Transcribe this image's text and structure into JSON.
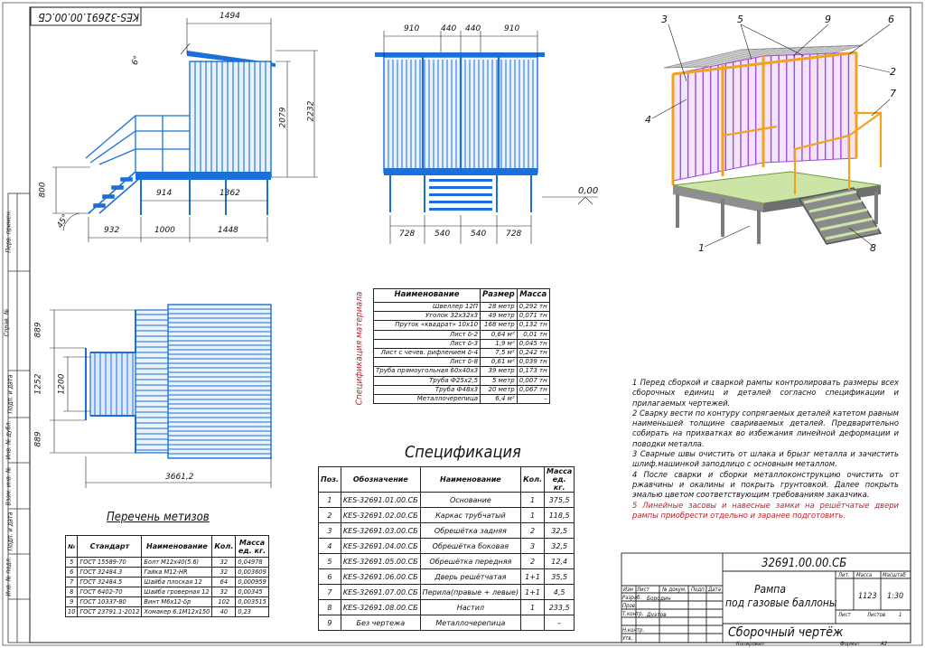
{
  "colors": {
    "structure": "#1a6fd8",
    "violet": "#a14bd6",
    "orange": "#f3a21a",
    "green_top": "#cce5a6",
    "steel": "#7d7d7d",
    "red_text": "#c0202a"
  },
  "stamp_top": "KES-32691.00.00.СБ",
  "side_view": {
    "dim_top": "1494",
    "angle": "6°",
    "dim_h1": "2079",
    "dim_h2": "2232",
    "dim_rail": "800",
    "angle_bottom": "45°",
    "dim_a": "914",
    "dim_b": "1362",
    "dim_c": "932",
    "dim_d": "1000",
    "dim_e": "1448"
  },
  "front_view": {
    "top_dims": [
      "910",
      "440",
      "440",
      "910"
    ],
    "bottom_dims": [
      "728",
      "540",
      "540",
      "728"
    ],
    "level": "0,00"
  },
  "plan_view": {
    "dims_left": [
      "889",
      "1252",
      "1200",
      "889"
    ],
    "dim_bottom": "3661,2"
  },
  "iso_view": {
    "callouts": [
      "3",
      "5",
      "9",
      "6",
      "2",
      "7",
      "4",
      "1",
      "8"
    ]
  },
  "side_stamp_labels": [
    "Перв. примен.",
    "Справ. №",
    "Подп. и дата",
    "Инв. № дубл.",
    "Взам. инв. №",
    "Подп. и дата",
    "Инв. № подл."
  ],
  "materials": {
    "vertical_title": "Спецификация материала",
    "headers": [
      "Наименование",
      "Размер",
      "Масса"
    ],
    "rows": [
      [
        "Швеллер 12П",
        "28 метр",
        "0,292 тн"
      ],
      [
        "Уголок 32х32х3",
        "49 метр",
        "0,071 тн"
      ],
      [
        "Пруток «квадрат» 10х10",
        "168 метр",
        "0,132 тн"
      ],
      [
        "Лист δ-2",
        "0,64 м²",
        "0,01 тн"
      ],
      [
        "Лист δ-3",
        "1,9 м²",
        "0,045 тн"
      ],
      [
        "Лист с чечев. рифлением δ-4",
        "7,5 м²",
        "0,242 тн"
      ],
      [
        "Лист δ-8",
        "0,61 м²",
        "0,039 тн"
      ],
      [
        "Труба прямоугольная 60х40х3",
        "39 метр",
        "0,173 тн"
      ],
      [
        "Труба Ф25х2,5",
        "5 метр",
        "0,007 тн"
      ],
      [
        "Труба Ф48х3",
        "20 метр",
        "0,067 тн"
      ],
      [
        "Металлочерепица",
        "6,4 м²",
        "–"
      ]
    ]
  },
  "spec": {
    "title": "Спецификация",
    "headers": [
      "Поз.",
      "Обозначение",
      "Наименование",
      "Кол.",
      "Масса ед. кг."
    ],
    "rows": [
      [
        "1",
        "KES-32691.01.00.СБ",
        "Основание",
        "1",
        "375,5"
      ],
      [
        "2",
        "KES-32691.02.00.СБ",
        "Каркас трубчатый",
        "1",
        "118,5"
      ],
      [
        "3",
        "KES-32691.03.00.СБ",
        "Обрешётка задняя",
        "2",
        "32,5"
      ],
      [
        "4",
        "KES-32691.04.00.СБ",
        "Обрешётка боковая",
        "3",
        "32,5"
      ],
      [
        "5",
        "KES-32691.05.00.СБ",
        "Обрешётка передняя",
        "2",
        "12,4"
      ],
      [
        "6",
        "KES-32691.06.00.СБ",
        "Дверь решётчатая",
        "1+1",
        "35,5"
      ],
      [
        "7",
        "KES-32691.07.00.СБ",
        "Перила(правые + левые)",
        "1+1",
        "4,5"
      ],
      [
        "8",
        "KES-32691.08.00.СБ",
        "Настил",
        "1",
        "233,5"
      ],
      [
        "9",
        "Без чертежа",
        "Металлочерепица",
        "",
        "–"
      ]
    ]
  },
  "hardware": {
    "title": "Перечень метизов",
    "headers": [
      "№",
      "Стандарт",
      "Наименование",
      "Кол.",
      "Масса ед. кг."
    ],
    "rows": [
      [
        "5",
        "ГОСТ 15589-70",
        "Болт М12х40(5.6)",
        "32",
        "0,04978"
      ],
      [
        "6",
        "ГОСТ 32484.3",
        "Гайка М12-НR",
        "32",
        "0,003609"
      ],
      [
        "7",
        "ГОСТ 32484.5",
        "Шайба плоская 12",
        "64",
        "0,000959"
      ],
      [
        "8",
        "ГОСТ 6402-70",
        "Шайба гроверная 12",
        "32",
        "0,00345"
      ],
      [
        "9",
        "ГОСТ 10337-80",
        "Винт М6х12-δр",
        "102",
        "0,003515"
      ],
      [
        "10",
        "ГОСТ 23791.1-2012",
        "Хомакер 6.1М12х150",
        "40",
        "0,23"
      ]
    ]
  },
  "notes": [
    "1 Перед сборкой и сваркой рампы контролировать размеры всех сборочных единиц и деталей согласно спецификации и прилагаемых чертежей.",
    "2 Сварку вести по контуру сопрягаемых деталей катетом равным наименьшей толщине свариваемых деталей. Предварительно собирать на прихватках во избежания линейной деформации и поводки металла.",
    "3 Сварные швы очистить от шлака и брызг металла и зачистить шлиф.машинкой заподлицо с основным металлом.",
    "4 После сварки и сборки металлоконструкцию очистить от ржавчины и окалины и покрыть грунтовкой. Далее покрыть эмалью цветом соответствующим требованиям заказчика.",
    "5 Линейные засовы и навесные замки на решётчатые двери рампы приобрести отдельно и заранее подготовить."
  ],
  "title_block": {
    "doc_number": "32691.00.00.СБ",
    "name_line1": "Рампа",
    "name_line2": "под газовые баллоны",
    "doc_type": "Сборочный чертёж",
    "col_labels": [
      "Изм",
      "Лист",
      "№ докум.",
      "Подп.",
      "Дата"
    ],
    "roles": [
      "Разраб.",
      "Пров.",
      "Т.контр.",
      "Н.контр.",
      "Утв."
    ],
    "people": [
      "Бородин",
      "",
      "Дуэтов",
      "",
      ""
    ],
    "lit_label": "Лит.",
    "mass_label": "Масса",
    "scale_label": "Масштаб",
    "mass": "1123",
    "scale": "1:30",
    "sheet_label": "Лист",
    "sheets_label": "Листов",
    "sheets": "1",
    "copied": "Копировал",
    "format_label": "Формат",
    "format": "А2"
  }
}
